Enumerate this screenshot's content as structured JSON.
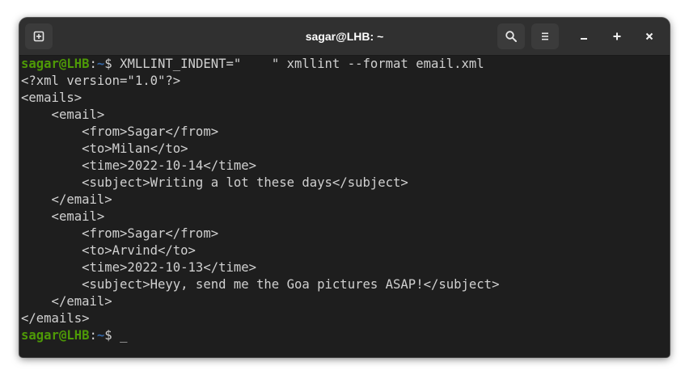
{
  "window": {
    "title": "sagar@LHB: ~"
  },
  "toolbar": {
    "new_tab_icon": "new-tab-icon",
    "search_icon": "search-icon",
    "menu_icon": "hamburger-menu-icon",
    "minimize_icon": "minimize-icon",
    "maximize_icon": "maximize-icon",
    "close_icon": "close-icon"
  },
  "colors": {
    "prompt_user": "#4e9a06",
    "prompt_path": "#3465a4",
    "text": "#d0d0d0",
    "background": "#1e1e1e",
    "titlebar": "#303030"
  },
  "terminal": {
    "prompt1": {
      "user": "sagar@LHB",
      "sep": ":",
      "path": "~",
      "symbol": "$ ",
      "command": "XMLLINT_INDENT=\"    \" xmllint --format email.xml"
    },
    "output": [
      "<?xml version=\"1.0\"?>",
      "<emails>",
      "    <email>",
      "        <from>Sagar</from>",
      "        <to>Milan</to>",
      "        <time>2022-10-14</time>",
      "        <subject>Writing a lot these days</subject>",
      "    </email>",
      "    <email>",
      "        <from>Sagar</from>",
      "        <to>Arvind</to>",
      "        <time>2022-10-13</time>",
      "        <subject>Heyy, send me the Goa pictures ASAP!</subject>",
      "    </email>",
      "</emails>"
    ],
    "prompt2": {
      "user": "sagar@LHB",
      "sep": ":",
      "path": "~",
      "symbol": "$ ",
      "cursor": "_"
    }
  }
}
